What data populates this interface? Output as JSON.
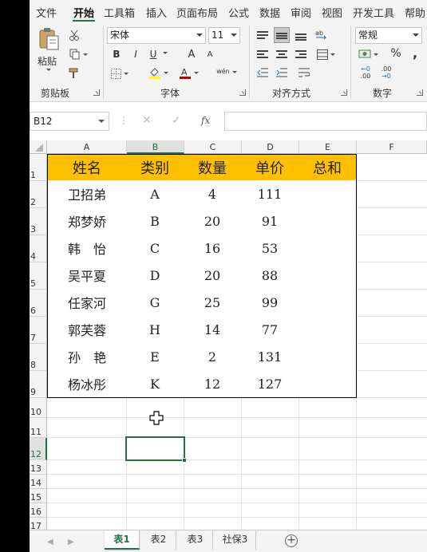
{
  "menu": {
    "tabs": [
      "文件",
      "开始",
      "工具箱",
      "插入",
      "页面布局",
      "公式",
      "数据",
      "审阅",
      "视图",
      "开发工具",
      "帮助"
    ],
    "active": "开始"
  },
  "ribbon": {
    "clipboard": {
      "label": "剪贴板",
      "paste_label": "粘贴"
    },
    "font": {
      "label": "字体",
      "font_name": "宋体",
      "font_size": "11",
      "bold": "B",
      "italic": "I",
      "underline": "U",
      "grow": "A",
      "shrink": "A",
      "phonetic": "wén"
    },
    "alignment": {
      "label": "对齐方式"
    },
    "number": {
      "label": "数字",
      "format": "常规",
      "percent": "%",
      "comma": ",",
      "inc_decimal": ".00",
      "dec_decimal": ".00"
    }
  },
  "formula_bar": {
    "name_box": "B12",
    "fx_label": "fx",
    "formula": ""
  },
  "grid": {
    "columns": [
      "A",
      "B",
      "C",
      "D",
      "E",
      "F"
    ],
    "rows": [
      "1",
      "2",
      "3",
      "4",
      "5",
      "6",
      "7",
      "8",
      "9",
      "10",
      "11",
      "12",
      "13",
      "14",
      "15",
      "16",
      "17"
    ],
    "selected_cell": "B12",
    "header_fill": "#ffc000",
    "table_headers": [
      "姓名",
      "类别",
      "数量",
      "单价",
      "总和"
    ],
    "table_rows": [
      [
        "卫招弟",
        "A",
        "4",
        "111",
        ""
      ],
      [
        "郑梦娇",
        "B",
        "20",
        "91",
        ""
      ],
      [
        "韩　怡",
        "C",
        "16",
        "53",
        ""
      ],
      [
        "吴平夏",
        "D",
        "20",
        "88",
        ""
      ],
      [
        "任家河",
        "G",
        "25",
        "99",
        ""
      ],
      [
        "郭芙蓉",
        "H",
        "14",
        "77",
        ""
      ],
      [
        "孙　艳",
        "E",
        "2",
        "131",
        ""
      ],
      [
        "杨冰彤",
        "K",
        "12",
        "127",
        ""
      ]
    ]
  },
  "sheet_tabs": {
    "tabs": [
      "表1",
      "表2",
      "表3",
      "社保3"
    ],
    "active": "表1",
    "add_icon": "plus-circle-icon"
  },
  "colors": {
    "accent": "#217346",
    "header_fill": "#ffc000"
  }
}
